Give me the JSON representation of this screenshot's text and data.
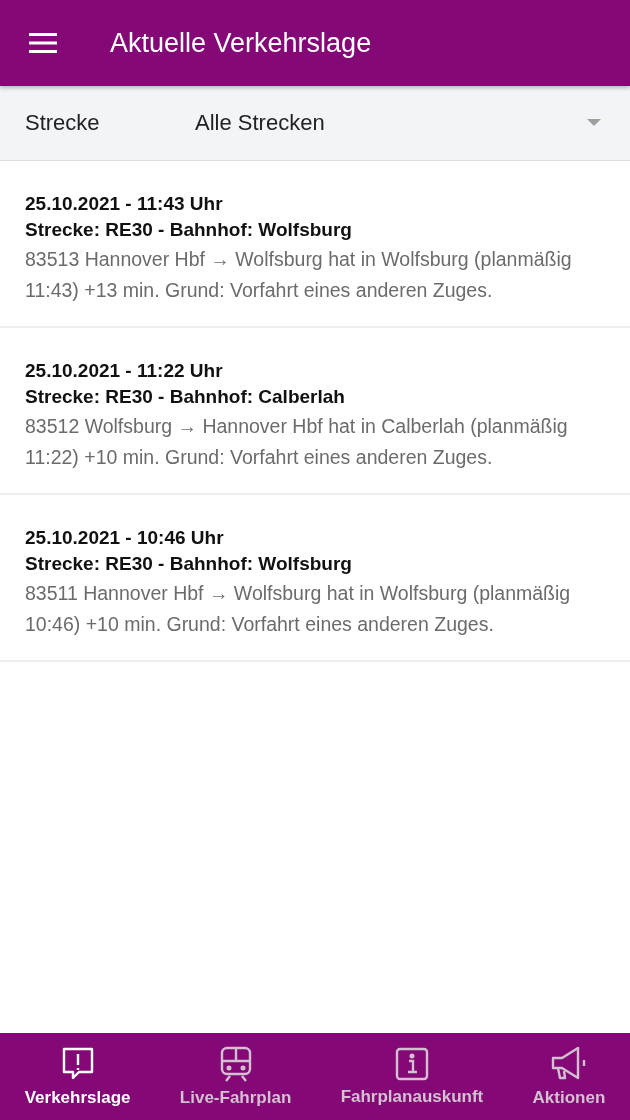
{
  "app_bar": {
    "title": "Aktuelle Verkehrslage"
  },
  "filter": {
    "label": "Strecke",
    "value": "Alle Strecken"
  },
  "messages": [
    {
      "time": "25.10.2021 - 11:43 Uhr",
      "route": "Strecke: RE30 - Bahnhof: Wolfsburg",
      "text": "83513 Hannover Hbf → Wolfsburg hat in Wolfsburg (planmäßig 11:43) +13 min. Grund: Vorfahrt eines anderen Zuges."
    },
    {
      "time": "25.10.2021 - 11:22 Uhr",
      "route": "Strecke: RE30 - Bahnhof: Calberlah",
      "text": "83512 Wolfsburg → Hannover Hbf hat in Calberlah (planmäßig 11:22) +10 min. Grund: Vorfahrt eines anderen Zuges."
    },
    {
      "time": "25.10.2021 - 10:46 Uhr",
      "route": "Strecke: RE30 - Bahnhof: Wolfsburg",
      "text": "83511 Hannover Hbf → Wolfsburg hat in Wolfsburg (planmäßig 10:46) +10 min. Grund: Vorfahrt eines anderen Zuges."
    }
  ],
  "bottom_nav": [
    {
      "kind": "alert",
      "label": "Verkehrslage",
      "selected": true
    },
    {
      "kind": "train",
      "label": "Live-Fahrplan",
      "selected": false
    },
    {
      "kind": "info",
      "label": "Fahrplanauskunft",
      "selected": false
    },
    {
      "kind": "megaphone",
      "label": "Aktionen",
      "selected": false
    }
  ]
}
